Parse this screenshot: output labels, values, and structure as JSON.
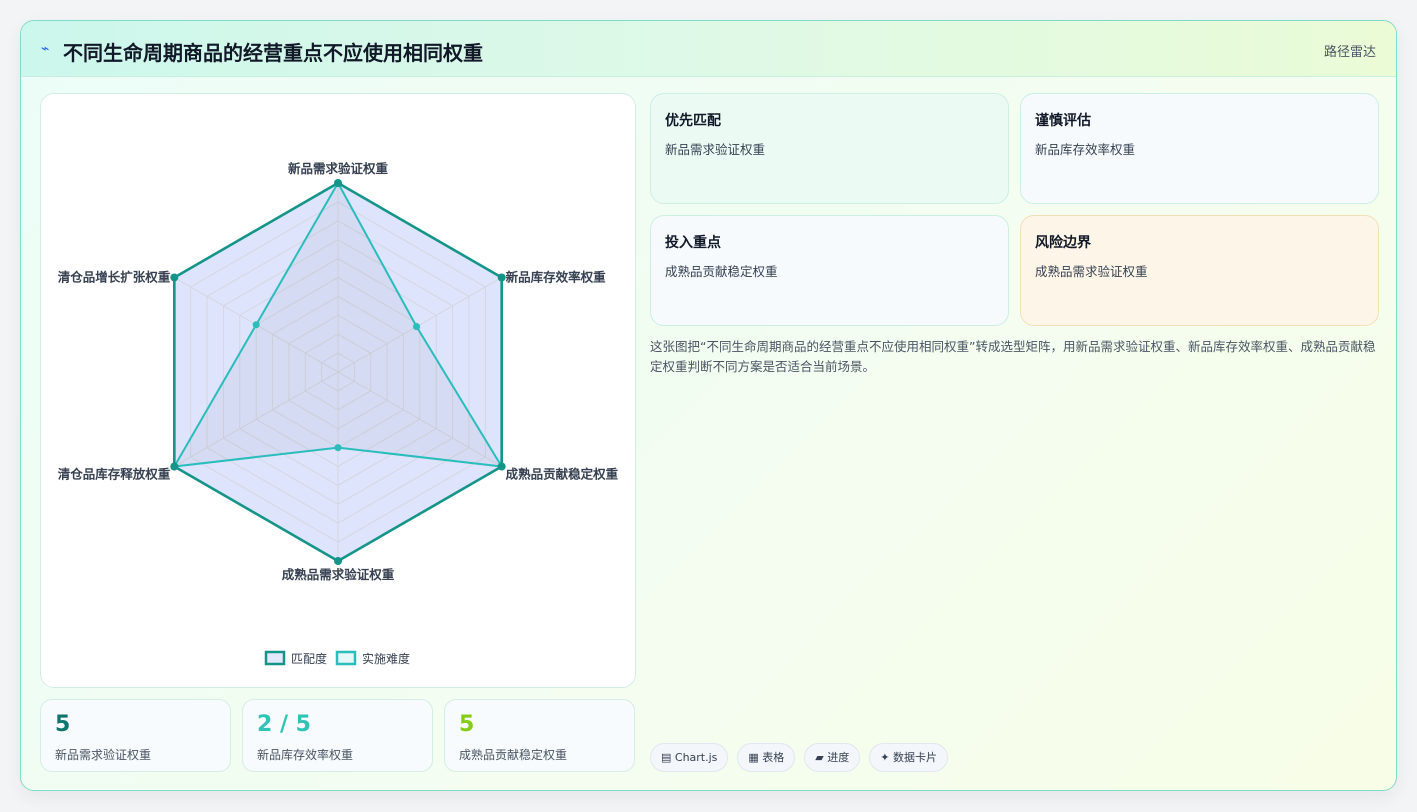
{
  "header": {
    "icon": "⌁",
    "title": "不同生命周期商品的经营重点不应使用相同权重",
    "tag": "路径雷达"
  },
  "colors": {
    "match": "#15958a",
    "match_fill": "rgba(99,130,235,0.22)",
    "difficulty": "#2bbcbc",
    "grid": "#d1d5db"
  },
  "chart_data": {
    "type": "radar",
    "axes": [
      "新品需求验证权重",
      "新品库存效率权重",
      "成熟品贡献稳定权重",
      "成熟品需求验证权重",
      "清仓品库存释放权重",
      "清仓品增长扩张权重"
    ],
    "rmax": 5,
    "grid_rings": 10,
    "series": [
      {
        "name": "匹配度",
        "values": [
          5,
          5,
          5,
          5,
          5,
          5
        ]
      },
      {
        "name": "实施难度",
        "values": [
          5,
          2.4,
          5,
          2,
          5,
          2.5
        ]
      }
    ],
    "legend": [
      "匹配度",
      "实施难度"
    ],
    "legend_position": "bottom"
  },
  "stats": [
    {
      "value": "5",
      "label": "新品需求验证权重",
      "color": "#0f766e"
    },
    {
      "value": "2 / 5",
      "label": "新品库存效率权重",
      "color": "#2ec4b6"
    },
    {
      "value": "5",
      "label": "成熟品贡献稳定权重",
      "color": "#84cc16"
    }
  ],
  "tiles": [
    {
      "title": "优先匹配",
      "sub": "新品需求验证权重"
    },
    {
      "title": "谨慎评估",
      "sub": "新品库存效率权重"
    },
    {
      "title": "投入重点",
      "sub": "成熟品贡献稳定权重"
    },
    {
      "title": "风险边界",
      "sub": "成熟品需求验证权重"
    }
  ],
  "description": "这张图把“不同生命周期商品的经营重点不应使用相同权重”转成选型矩阵，用新品需求验证权重、新品库存效率权重、成熟品贡献稳定权重判断不同方案是否适合当前场景。",
  "chips": [
    "▤ Chart.js",
    "▦ 表格",
    "▰ 进度",
    "✦ 数据卡片"
  ]
}
